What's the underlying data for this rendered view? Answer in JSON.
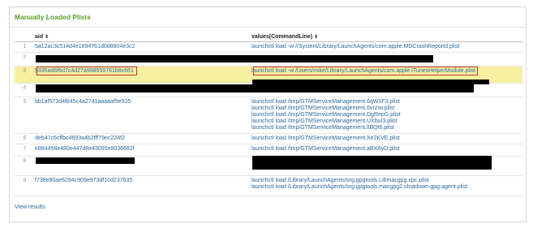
{
  "panel": {
    "title": "Manually Loaded Plists"
  },
  "columns": {
    "aid": "aid",
    "values": "values(CommandLine)",
    "sort_glyph": "⬍"
  },
  "rows": [
    {
      "num": "1",
      "aid": "5a12ac3c514d4e1894761d0d8804e3c2",
      "values": [
        "launchctl load -w //System/Library/LaunchAgents/com.apple.MDCrashReportd.plist"
      ]
    },
    {
      "num": "2",
      "aid": "",
      "values": [
        ""
      ],
      "redacted": true
    },
    {
      "num": "3",
      "aid": "9335ad6f6d7c4d27a998559761b8c661",
      "values": [
        "launchctl load -w /Users/mike/Library/LaunchAgents/com.apple.iTunesHelperModule.plist",
        ""
      ],
      "highlighted": true
    },
    {
      "num": "4",
      "aid": "",
      "values": [
        ""
      ],
      "redacted": true
    },
    {
      "num": "5",
      "aid": "bb1af573d4f845c4a2741aaaaaf9e935",
      "values": [
        "launchctl load /tmp/GTMServiceManagement.6qW1F3.plist",
        "launchctl load /tmp/GTMServiceManagement.6vrz!w.plist",
        "launchctl load /tmp/GTMServiceManagement.DgRepG.plist",
        "launchctl load /tmp/GTMServiceManagement.UXbuI3.plist",
        "launchctl load /tmp/GTMServiceManagement.lIBQt6.plist"
      ]
    },
    {
      "num": "6",
      "aid": "deb47c6cffbc4693a4b2fff79ec224f2",
      "values": [
        "launchctl load /tmp/GTMServiceManagement.Xe2KVE.plist"
      ]
    },
    {
      "num": "7",
      "aid": "e884458e480e447d8e43095e8036682f",
      "values": [
        "launchctl load /tmp/GTMServiceManagement.aBXAyD.plist"
      ]
    },
    {
      "num": "8",
      "aid": "",
      "values": [
        "",
        ""
      ],
      "redacted": true
    },
    {
      "num": "9",
      "aid": "f738e80ae6294c909e973df10d237635",
      "values": [
        "launchctl load /Library/LaunchAgents/org.gpgtools.Libmacgpg.xpc.plist",
        "launchctl load /Library/LaunchAgents/org.gpgtools.macgpg2.shutdown-gpg-agent.plist"
      ]
    }
  ],
  "footer": {
    "view_results": "View results"
  }
}
